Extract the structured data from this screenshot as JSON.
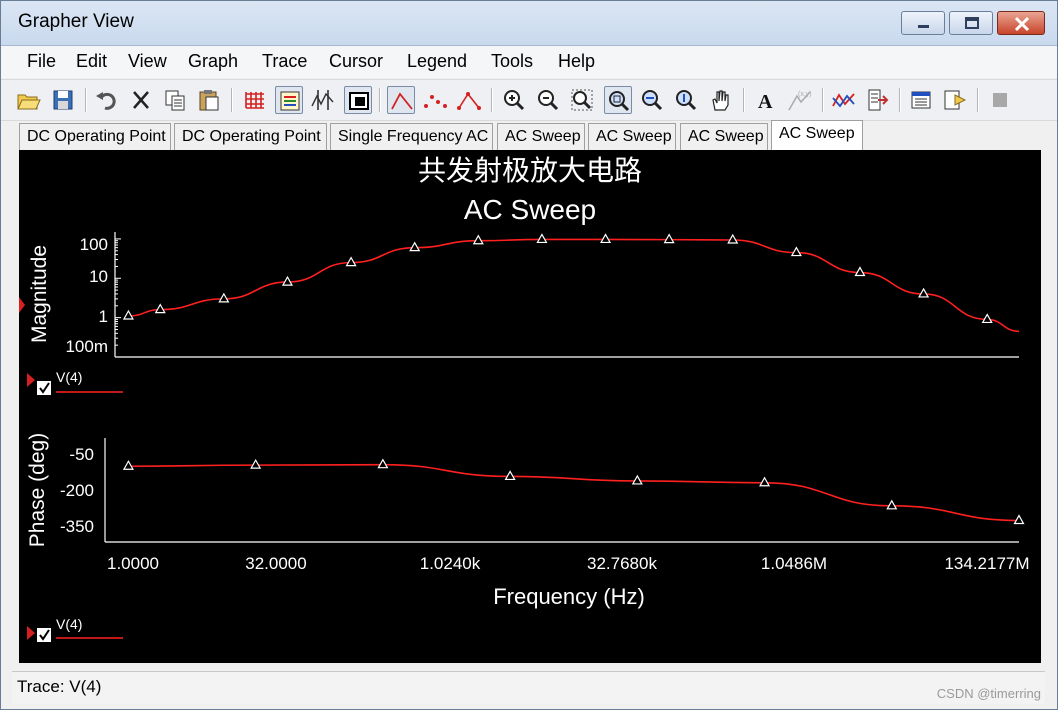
{
  "window": {
    "title": "Grapher View"
  },
  "menu": [
    "File",
    "Edit",
    "View",
    "Graph",
    "Trace",
    "Cursor",
    "Legend",
    "Tools",
    "Help"
  ],
  "toolbar_icons": [
    "open-icon",
    "save-icon",
    "undo-icon",
    "cut-icon",
    "copy-icon",
    "paste-icon",
    "grid-icon",
    "legend-icon",
    "cursors-icon",
    "reverse-colors-icon",
    "line-plot-icon",
    "dots-plot-icon",
    "line-dots-plot-icon",
    "zoom-in-icon",
    "zoom-out-icon",
    "zoom-area-icon",
    "zoom-full-icon",
    "zoom-x-icon",
    "zoom-y-icon",
    "pan-icon",
    "text-icon",
    "label-icon",
    "overlay-icon",
    "export-icon",
    "properties-icon",
    "transfer-icon",
    "stop-icon"
  ],
  "tabs": [
    "DC Operating Point",
    "DC Operating Point",
    "Single Frequency AC",
    "AC Sweep",
    "AC Sweep",
    "AC Sweep",
    "AC Sweep"
  ],
  "active_tab": 6,
  "plot": {
    "title_cn": "共发射极放大电路",
    "title": "AC Sweep",
    "magnitude_ylabel": "Magnitude",
    "phase_ylabel": "Phase (deg)",
    "xlabel": "Frequency (Hz)",
    "mag_ticks": [
      "100",
      "10",
      "1",
      "100m"
    ],
    "phase_ticks": [
      "-50",
      "-200",
      "-350"
    ],
    "x_ticks": [
      "1.0000",
      "32.0000",
      "1.0240k",
      "32.7680k",
      "1.0486M",
      "134.2177M"
    ],
    "legend_top": "V(4)",
    "legend_bottom": "V(4)",
    "trace_color": "#ff2020",
    "background": "#000000"
  },
  "status": {
    "text": "Trace: V(4)"
  },
  "watermark": "CSDN @timerring",
  "chart_data": [
    {
      "type": "line",
      "title": "AC Sweep",
      "xlabel": "Frequency (Hz)",
      "ylabel": "Magnitude",
      "x_scale": "log",
      "y_scale": "log",
      "xlim": [
        0.6,
        268435456
      ],
      "ylim": [
        0.1,
        150
      ],
      "series": [
        {
          "name": "V(4)",
          "x": [
            1,
            2,
            8,
            32,
            128,
            512,
            2048,
            8192,
            32768,
            131072,
            524288,
            2097152,
            8388608,
            33554432,
            134217728,
            268435456
          ],
          "values": [
            1.1,
            1.6,
            3.0,
            8.0,
            25,
            60,
            90,
            97,
            97,
            96,
            94,
            45,
            14,
            4.0,
            0.9,
            0.45
          ]
        }
      ]
    },
    {
      "type": "line",
      "xlabel": "Frequency (Hz)",
      "ylabel": "Phase (deg)",
      "x_scale": "log",
      "xlim": [
        0.6,
        268435456
      ],
      "ylim": [
        -420,
        40
      ],
      "series": [
        {
          "name": "V(4)",
          "x": [
            1,
            16,
            256,
            4096,
            65536,
            1048576,
            16777216,
            268435456
          ],
          "values": [
            -85,
            -80,
            -78,
            -130,
            -150,
            -158,
            -260,
            -325
          ]
        }
      ]
    }
  ]
}
